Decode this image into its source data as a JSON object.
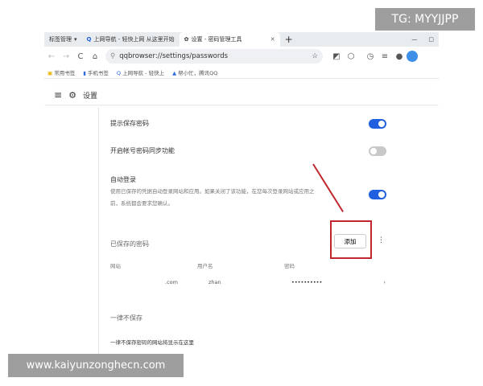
{
  "tabs": [
    {
      "label": "标签管理",
      "icon": "chevron-down-icon"
    },
    {
      "label": "上网导航 - 轻快上网 从这里开始",
      "icon": "qq-browser-icon"
    },
    {
      "label": "设置 - 密码管理工具",
      "icon": "gear-icon",
      "active": true
    }
  ],
  "address": {
    "url": "qqbrowser://settings/passwords"
  },
  "bookmarks": [
    "常用书签",
    "手机书签",
    "上网导航 - 轻快上",
    "帮小忙，腾讯QQ"
  ],
  "settings": {
    "title": "设置"
  },
  "options": [
    {
      "label": "提示保存密码",
      "enabled": true
    },
    {
      "label": "开启帐号密码同步功能",
      "enabled": false
    },
    {
      "label": "自动登录",
      "description_line1": "使用已保存的凭据自动登录网站和应用。如果关闭了该功能，在您每次登录网站或应用之",
      "description_line2": "前，系统都会要求您确认。",
      "enabled": true
    }
  ],
  "saved": {
    "title": "已保存的密码",
    "add_label": "添加",
    "columns": [
      "网站",
      "用户名",
      "密码"
    ],
    "rows": [
      {
        "site": ".com",
        "username": "zhan",
        "password": "••••••••••"
      }
    ]
  },
  "never": {
    "title": "一律不保存",
    "empty": "一律不保存密码的网站将显示在这里"
  },
  "watermark_tg": "TG: MYYJJPP",
  "watermark_site": "www.kaiyunzonghecn.com",
  "colors": {
    "accent": "#1f5fe0",
    "highlight": "#c0262e"
  }
}
